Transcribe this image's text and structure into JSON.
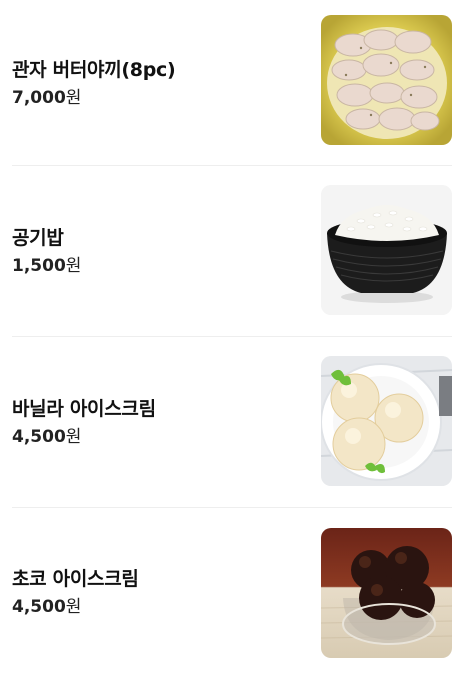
{
  "menu": {
    "items": [
      {
        "name": "관자 버터야끼(8pc)",
        "price": "7,000",
        "currency": "원",
        "image": "scallop-butter-photo"
      },
      {
        "name": "공기밥",
        "price": "1,500",
        "currency": "원",
        "image": "rice-bowl-photo"
      },
      {
        "name": "바닐라 아이스크림",
        "price": "4,500",
        "currency": "원",
        "image": "vanilla-ice-cream-photo"
      },
      {
        "name": "초코 아이스크림",
        "price": "4,500",
        "currency": "원",
        "image": "chocolate-ice-cream-photo"
      }
    ]
  }
}
